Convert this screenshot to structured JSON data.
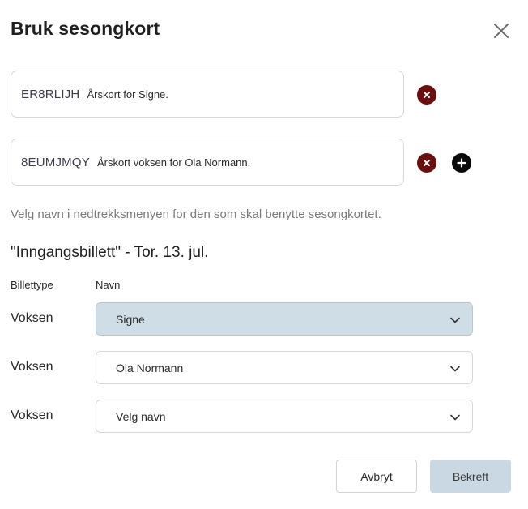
{
  "dialog": {
    "title": "Bruk sesongkort",
    "close_icon": "close-icon"
  },
  "cards": [
    {
      "code": "ER8RLIJH",
      "description": "Årskort for Signe.",
      "remove_icon": "remove-circle-icon"
    },
    {
      "code": "8EUMJMQY",
      "description": "Årskort voksen for Ola Normann.",
      "remove_icon": "remove-circle-icon",
      "add_icon": "add-circle-icon"
    }
  ],
  "hint": "Velg navn i nedtrekksmenyen for den som skal benytte sesongkortet.",
  "event_title": "\"Inngangsbillett\" - Tor. 13. jul.",
  "table": {
    "headers": [
      "Billettype",
      "Navn"
    ],
    "rows": [
      {
        "type": "Voksen",
        "name": "Signe"
      },
      {
        "type": "Voksen",
        "name": "Ola Normann"
      },
      {
        "type": "Voksen",
        "name": "Velg navn"
      }
    ]
  },
  "buttons": {
    "cancel": "Avbryt",
    "confirm": "Bekreft"
  },
  "colors": {
    "remove": "#6b0e0e",
    "add": "#0a0a0a",
    "selected_select_bg": "#cfdde6",
    "confirm_bg": "#c9d8e3"
  }
}
